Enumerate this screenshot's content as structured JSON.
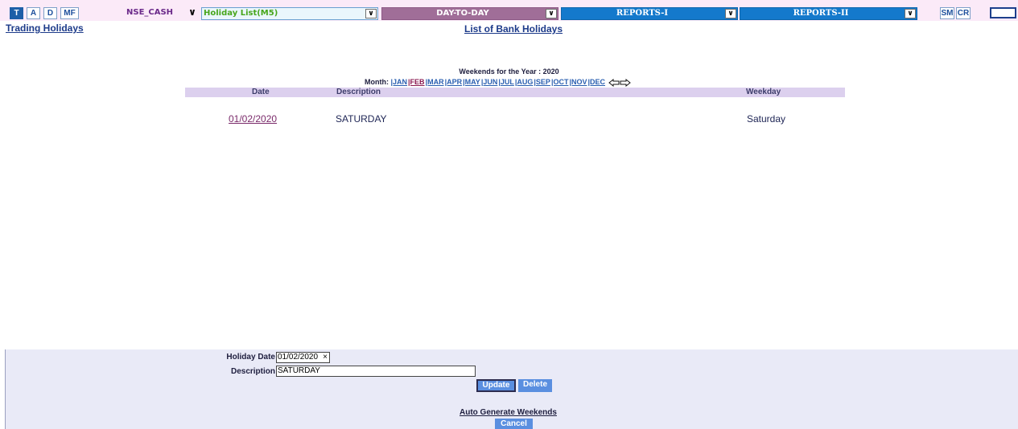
{
  "toolbar": {
    "buttons": [
      "T",
      "A",
      "D",
      "MF"
    ],
    "exchange_select": "NSE_CASH",
    "page_select": "Holiday List(M5)",
    "day_to_day_select": "DAY-TO-DAY",
    "reports1_select": "REPORTS-I",
    "reports2_select": "REPORTS-II",
    "right_buttons": [
      "SM",
      "CR"
    ],
    "dropdown_glyph": "∨"
  },
  "header": {
    "left_link": "Trading Holidays",
    "title": "List of Bank Holidays"
  },
  "weekends": {
    "year_line": "Weekends for the Year : 2020",
    "month_label": "Month:",
    "months": [
      "|JAN",
      "|FEB",
      "|MAR",
      "|APR",
      "|MAY",
      "|JUN",
      "|JUL",
      "|AUG",
      "|SEP",
      "|OCT",
      "|NOV",
      "|DEC"
    ],
    "current_month": "|FEB",
    "columns": {
      "date": "Date",
      "description": "Description",
      "weekday": "Weekday"
    },
    "rows": [
      {
        "date": "01/02/2020",
        "description": "SATURDAY",
        "weekday": "Saturday"
      }
    ]
  },
  "form": {
    "holiday_date_label": "Holiday Date",
    "holiday_date_value": "01/02/2020",
    "clear_glyph": "×",
    "description_label": "Description",
    "description_value": "SATURDAY",
    "update_label": "Update",
    "delete_label": "Delete",
    "auto_generate_label": "Auto Generate Weekends",
    "cancel_label": "Cancel"
  },
  "colors": {
    "toolbar_bg": "#fbeaf8",
    "day_to_day": "#a06e98",
    "reports": "#1479cc",
    "table_header": "#dcd0ee",
    "form_panel": "#e9eaf7",
    "button_blue": "#5a8fe0"
  }
}
